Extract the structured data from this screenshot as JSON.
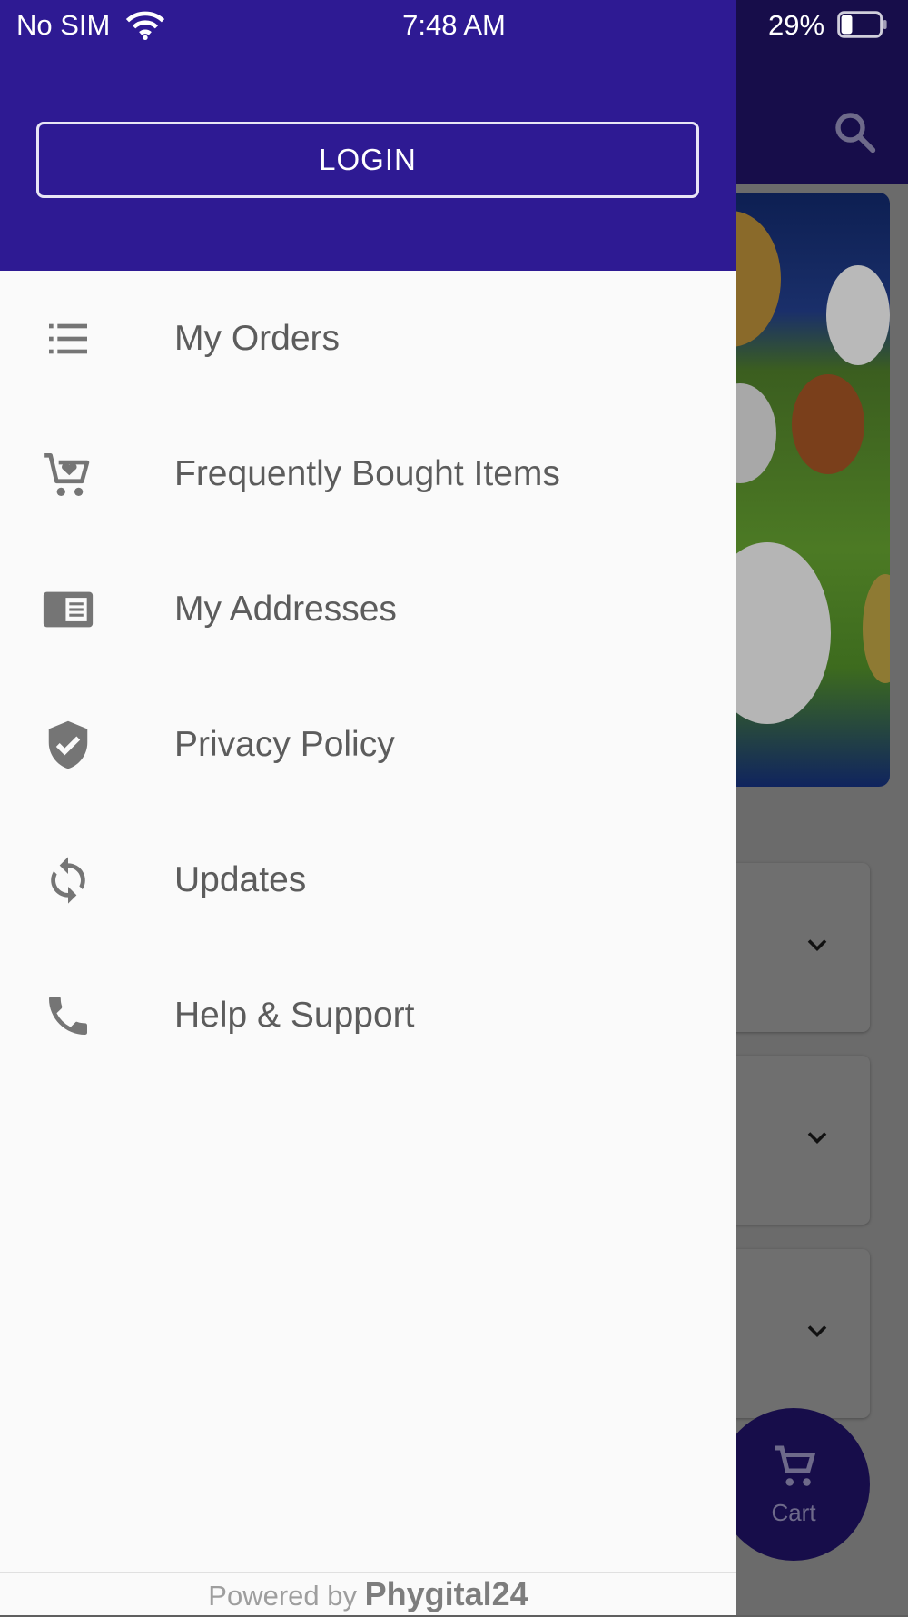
{
  "status_bar": {
    "carrier": "No SIM",
    "time": "7:48 AM",
    "battery_percent": "29%",
    "battery_level": 0.29
  },
  "drawer": {
    "login_label": "LOGIN",
    "menu_items": [
      {
        "label": "My Orders",
        "icon": "list-icon"
      },
      {
        "label": "Frequently Bought Items",
        "icon": "cart-heart-icon"
      },
      {
        "label": "My Addresses",
        "icon": "address-card-icon"
      },
      {
        "label": "Privacy Policy",
        "icon": "shield-check-icon"
      },
      {
        "label": "Updates",
        "icon": "sync-icon"
      },
      {
        "label": "Help & Support",
        "icon": "phone-icon"
      }
    ],
    "footer": {
      "prefix": "Powered by",
      "brand": "Phygital24"
    }
  },
  "background": {
    "fab_label": "Cart"
  },
  "colors": {
    "drawer_header": "#2e1a93",
    "app_header_dimmed": "#170d4a",
    "menu_icon": "#757575",
    "menu_text": "#5c5c5c"
  }
}
